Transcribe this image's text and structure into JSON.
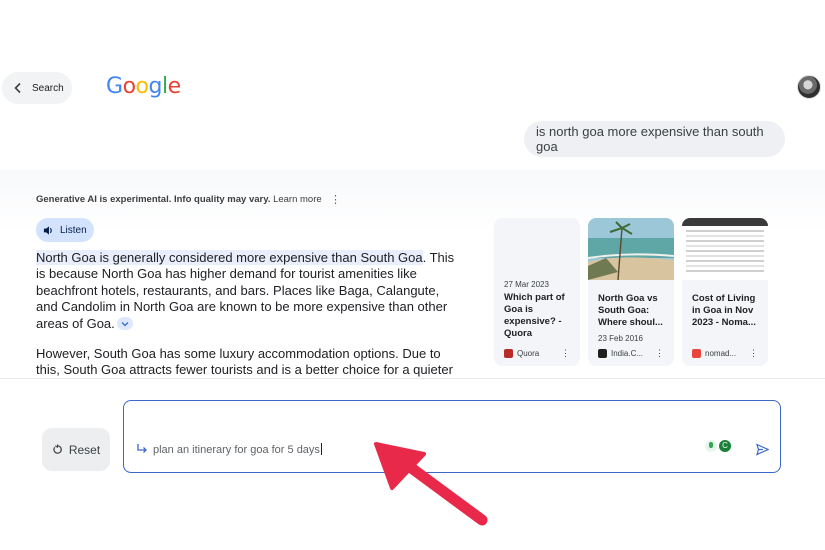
{
  "header": {
    "back_label": "Search",
    "logo": [
      {
        "ch": "G",
        "color": "#4285F4"
      },
      {
        "ch": "o",
        "color": "#EA4335"
      },
      {
        "ch": "o",
        "color": "#FBBC05"
      },
      {
        "ch": "g",
        "color": "#4285F4"
      },
      {
        "ch": "l",
        "color": "#34A853"
      },
      {
        "ch": "e",
        "color": "#EA4335"
      }
    ]
  },
  "query": "is north goa more expensive than south goa",
  "ai": {
    "disclaimer": "Generative AI is experimental. Info quality may vary.",
    "learn_more": "Learn more",
    "listen_label": "Listen",
    "para1_highlight": "North Goa is generally considered more expensive than South Goa",
    "para1_rest": ". This is because North Goa has higher demand for tourist amenities like beachfront hotels, restaurants, and bars. Places like Baga, Calangute, and Candolim in North Goa are known to be more expensive than other areas of Goa.",
    "para2": "However, South Goa has some luxury accommodation options. Due to this, South Goa attracts fewer tourists and is a better choice for a quieter and more luxurious stay. South Goa has cleaner and quieter beaches like Agonda"
  },
  "sources": [
    {
      "date": "27 Mar 2023",
      "title": "Which part of Goa is expensive? - Quora",
      "source": "Quora",
      "icon_color": "#b92b27"
    },
    {
      "date": "23 Feb 2016",
      "title": "North Goa vs South Goa: Where shoul...",
      "source": "India.C...",
      "icon_color": "#1f1f1f"
    },
    {
      "date": "",
      "title": "Cost of Living in Goa in Nov 2023 - Noma...",
      "source": "nomad...",
      "icon_color": "#e8453c"
    }
  ],
  "bottom": {
    "reset_label": "Reset",
    "prompt_text": "plan an itinerary for goa for 5 days",
    "extension_badge": "C"
  },
  "colors": {
    "accent": "#3b67c9",
    "annotation_arrow": "#e8294a"
  }
}
